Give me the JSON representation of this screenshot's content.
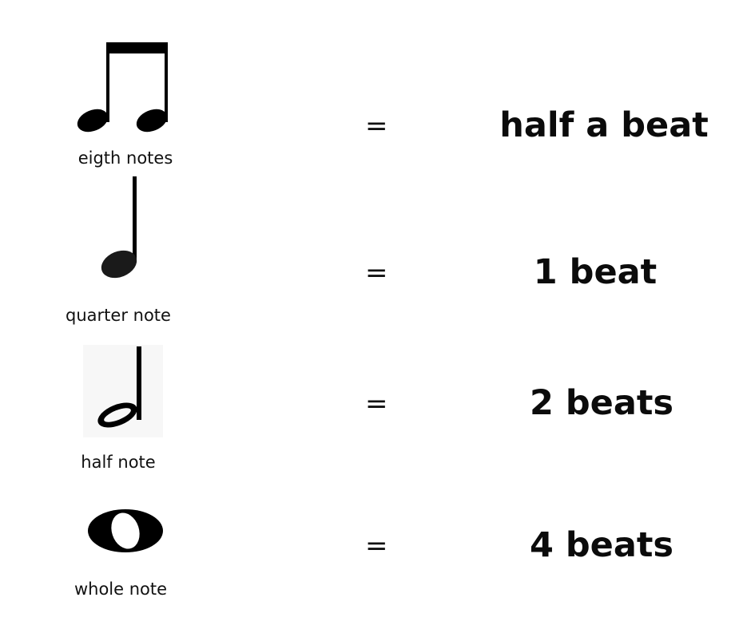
{
  "rows": [
    {
      "label": "eigth notes",
      "equals": "=",
      "value": "half a beat",
      "icon": "eighth-notes-icon"
    },
    {
      "label": "quarter note",
      "equals": "=",
      "value": "1 beat",
      "icon": "quarter-note-icon"
    },
    {
      "label": "half note",
      "equals": "=",
      "value": "2 beats",
      "icon": "half-note-icon"
    },
    {
      "label": "whole note",
      "equals": "=",
      "value": "4 beats",
      "icon": "whole-note-icon"
    }
  ]
}
